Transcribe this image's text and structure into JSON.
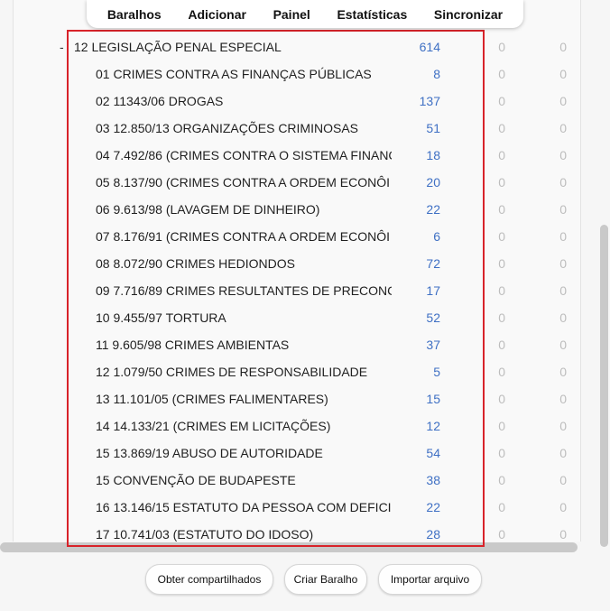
{
  "nav": {
    "items": [
      "Baralhos",
      "Adicionar",
      "Painel",
      "Estatísticas",
      "Sincronizar"
    ]
  },
  "parent": {
    "collapse": "-",
    "name": "12 LEGISLAÇÃO PENAL ESPECIAL",
    "new": "614",
    "learn": "0",
    "due": "0"
  },
  "decks": [
    {
      "name": "01 CRIMES CONTRA AS FINANÇAS PÚBLICAS",
      "new": "8",
      "learn": "0",
      "due": "0"
    },
    {
      "name": "02 11343/06 DROGAS",
      "new": "137",
      "learn": "0",
      "due": "0"
    },
    {
      "name": "03 12.850/13 ORGANIZAÇÕES CRIMINOSAS",
      "new": "51",
      "learn": "0",
      "due": "0"
    },
    {
      "name": "04 7.492/86 (CRIMES CONTRA O SISTEMA FINANC",
      "new": "18",
      "learn": "0",
      "due": "0"
    },
    {
      "name": "05 8.137/90 (CRIMES CONTRA A ORDEM ECONÔI",
      "new": "20",
      "learn": "0",
      "due": "0"
    },
    {
      "name": "06 9.613/98 (LAVAGEM DE DINHEIRO)",
      "new": "22",
      "learn": "0",
      "due": "0"
    },
    {
      "name": "07 8.176/91 (CRIMES CONTRA A ORDEM ECONÔI",
      "new": "6",
      "learn": "0",
      "due": "0"
    },
    {
      "name": "08 8.072/90 CRIMES HEDIONDOS",
      "new": "72",
      "learn": "0",
      "due": "0"
    },
    {
      "name": "09 7.716/89 CRIMES RESULTANTES DE PRECONCE",
      "new": "17",
      "learn": "0",
      "due": "0"
    },
    {
      "name": "10 9.455/97 TORTURA",
      "new": "52",
      "learn": "0",
      "due": "0"
    },
    {
      "name": "11 9.605/98 CRIMES AMBIENTAS",
      "new": "37",
      "learn": "0",
      "due": "0"
    },
    {
      "name": "12 1.079/50 CRIMES DE RESPONSABILIDADE",
      "new": "5",
      "learn": "0",
      "due": "0"
    },
    {
      "name": "13 11.101/05 (CRIMES FALIMENTARES)",
      "new": "15",
      "learn": "0",
      "due": "0"
    },
    {
      "name": "14 14.133/21 (CRIMES EM LICITAÇÕES)",
      "new": "12",
      "learn": "0",
      "due": "0"
    },
    {
      "name": "15 13.869/19 ABUSO DE AUTORIDADE",
      "new": "54",
      "learn": "0",
      "due": "0"
    },
    {
      "name": "15 CONVENÇÃO DE BUDAPESTE",
      "new": "38",
      "learn": "0",
      "due": "0"
    },
    {
      "name": "16 13.146/15 ESTATUTO DA PESSOA COM DEFICIÊ",
      "new": "22",
      "learn": "0",
      "due": "0"
    },
    {
      "name": "17 10.741/03 (ESTATUTO DO IDOSO)",
      "new": "28",
      "learn": "0",
      "due": "0"
    }
  ],
  "buttons": {
    "shared": "Obter compartilhados",
    "create": "Criar Baralho",
    "import": "Importar arquivo"
  },
  "colors": {
    "new_count": "#3f70c4",
    "zero_count": "#bdbdbd",
    "highlight": "#d8232a"
  }
}
